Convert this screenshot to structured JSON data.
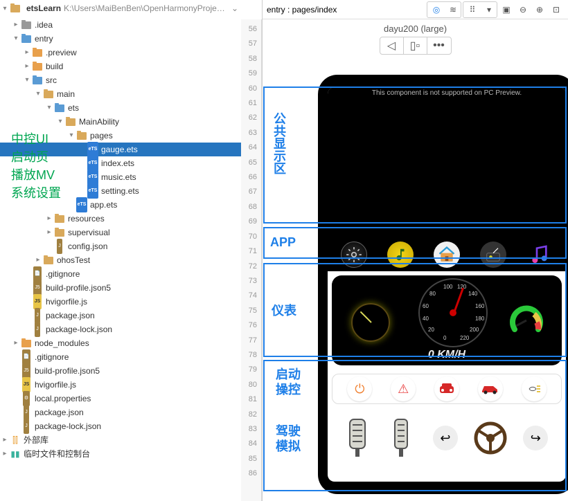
{
  "project": {
    "name": "etsLearn",
    "path": "K:\\Users\\MaiBenBen\\OpenHarmonyProjects\\ets"
  },
  "tree": {
    "idea": ".idea",
    "entry": "entry",
    "preview": ".preview",
    "build": "build",
    "src": "src",
    "main": "main",
    "ets": "ets",
    "mainability": "MainAbility",
    "pages": "pages",
    "gauge": "gauge.ets",
    "index": "index.ets",
    "music": "music.ets",
    "setting": "setting.ets",
    "app": "app.ets",
    "resources": "resources",
    "supervisual": "supervisual",
    "config": "config.json",
    "ohostest": "ohosTest",
    "gitignore1": ".gitignore",
    "buildprofile1": "build-profile.json5",
    "hvigorfile1": "hvigorfile.js",
    "package1": "package.json",
    "packagelock1": "package-lock.json",
    "nodemodules": "node_modules",
    "gitignore2": ".gitignore",
    "buildprofile2": "build-profile.json5",
    "hvigorfile2": "hvigorfile.js",
    "localprops": "local.properties",
    "package2": "package.json",
    "packagelock2": "package-lock.json",
    "extlib": "外部库",
    "tempfiles": "临时文件和控制台"
  },
  "preview": {
    "title": "entry : pages/index",
    "device": "dayu200 (large)",
    "nav_more": "•••"
  },
  "overlay": {
    "ui": "中控UI",
    "launch": "启动页",
    "mv": "播放MV",
    "settings": "系统设置"
  },
  "line_numbers": [
    "56",
    "57",
    "58",
    "59",
    "60",
    "61",
    "62",
    "63",
    "64",
    "65",
    "66",
    "67",
    "68",
    "69",
    "70",
    "71",
    "72",
    "73",
    "74",
    "75",
    "76",
    "77",
    "78",
    "79",
    "80",
    "81",
    "82",
    "83",
    "84",
    "85",
    "86"
  ],
  "device": {
    "warn": "This component is not supported on PC Preview.",
    "speed": "0 KM/H",
    "gauge_ticks": {
      "t100": "100",
      "t120": "120",
      "t140": "140",
      "t80": "80",
      "t160": "160",
      "t60": "60",
      "t180": "180",
      "t40": "40",
      "t200": "200",
      "t20": "20",
      "t220": "220",
      "t0": "0"
    }
  },
  "anno": {
    "public": "公共显示区",
    "app": "APP",
    "gauge": "仪表",
    "launchctl": "启动操控",
    "drive": "驾驶模拟"
  }
}
